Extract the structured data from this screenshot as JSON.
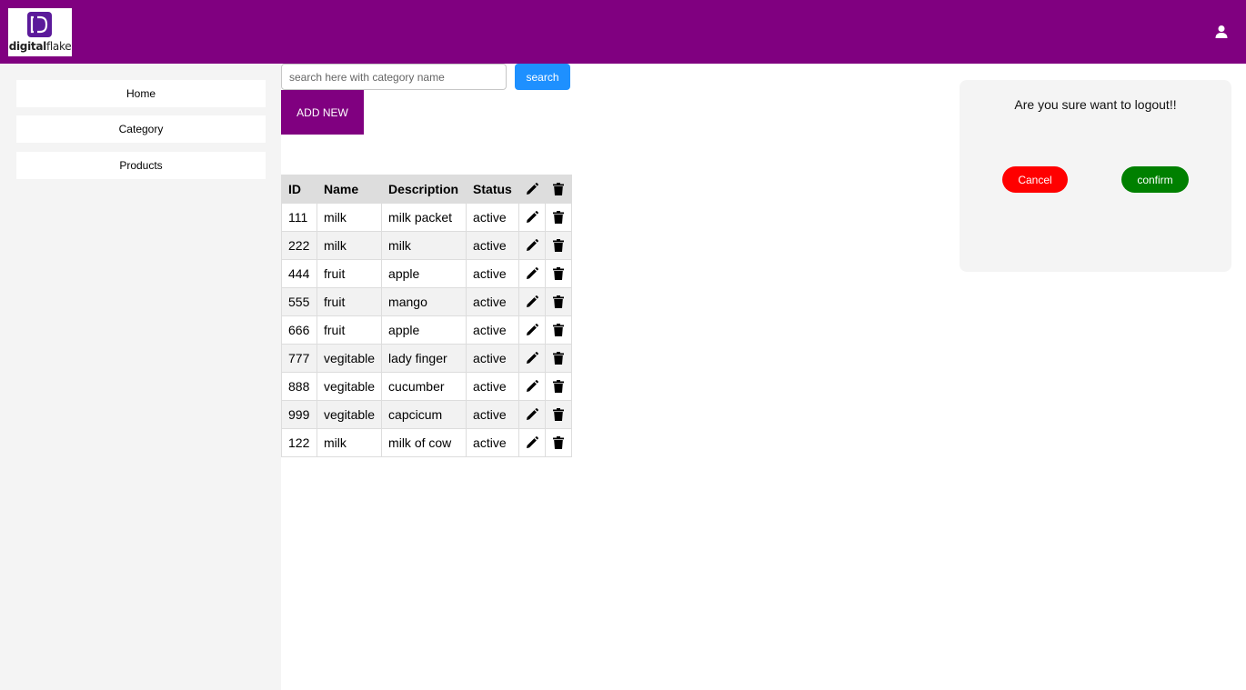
{
  "header": {
    "logo_text_bold": "digital",
    "logo_text": "flake",
    "user_icon": "user-icon",
    "bg_color": "#800080"
  },
  "sidebar": {
    "items": [
      {
        "label": "Home"
      },
      {
        "label": "Category"
      },
      {
        "label": "Products"
      }
    ]
  },
  "search": {
    "placeholder": "search here with category name",
    "value": "",
    "button_label": "search"
  },
  "add_button_label": "ADD NEW",
  "table": {
    "columns": [
      "ID",
      "Name",
      "Description",
      "Status"
    ],
    "edit_icon": "pencil-icon",
    "delete_icon": "trash-icon",
    "rows": [
      {
        "id": "111",
        "name": "milk",
        "description": "milk packet",
        "status": "active"
      },
      {
        "id": "222",
        "name": "milk",
        "description": "milk",
        "status": "active"
      },
      {
        "id": "444",
        "name": "fruit",
        "description": "apple",
        "status": "active"
      },
      {
        "id": "555",
        "name": "fruit",
        "description": "mango",
        "status": "active"
      },
      {
        "id": "666",
        "name": "fruit",
        "description": "apple",
        "status": "active"
      },
      {
        "id": "777",
        "name": "vegitable",
        "description": "lady finger",
        "status": "active"
      },
      {
        "id": "888",
        "name": "vegitable",
        "description": "cucumber",
        "status": "active"
      },
      {
        "id": "999",
        "name": "vegitable",
        "description": "capcicum",
        "status": "active"
      },
      {
        "id": "122",
        "name": "milk",
        "description": "milk of cow",
        "status": "active"
      }
    ]
  },
  "modal": {
    "message": "Are you sure want to logout!!",
    "cancel_label": "Cancel",
    "confirm_label": "confirm",
    "cancel_color": "#ff0000",
    "confirm_color": "#008000"
  }
}
